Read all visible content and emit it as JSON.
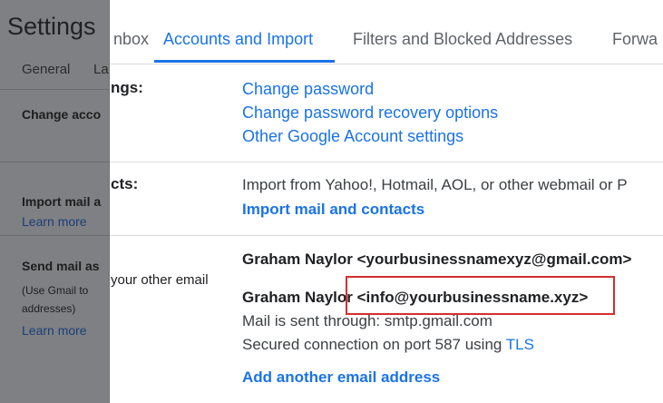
{
  "overlay": {
    "title": "Settings",
    "tabs": [
      "General",
      "La"
    ],
    "sections": {
      "change_account": "Change acco",
      "import_mail": "Import mail a",
      "import_learn_more": "Learn more",
      "send_mail": "Send mail as",
      "send_desc_1": "(Use Gmail to",
      "send_desc_2": "addresses)",
      "send_learn_more": "Learn more"
    }
  },
  "tabs": [
    "Inbox",
    "Accounts and Import",
    "Filters and Blocked Addresses",
    "Forwa"
  ],
  "tabs_visible": [
    "nbox",
    "Accounts and Import",
    "Filters and Blocked Addresses",
    "Forwa"
  ],
  "sections": {
    "change_account": {
      "label_tail": "ngs:",
      "links": [
        "Change password",
        "Change password recovery options",
        "Other Google Account settings"
      ]
    },
    "import": {
      "label_tail": "cts:",
      "description": "Import from Yahoo!, Hotmail, AOL, or other webmail or P",
      "link": "Import mail and contacts"
    },
    "send_mail_as": {
      "label_tail": "your other email",
      "address_1": "Graham Naylor <yourbusinessnamexyz@gmail.com>",
      "address_2": "Graham Naylor <info@yourbusinessname.xyz>",
      "sent_through": "Mail is sent through: smtp.gmail.com",
      "secured_prefix": "Secured connection on port 587 using",
      "secured_link": "TLS",
      "add_link": "Add another email address"
    }
  },
  "colors": {
    "accent": "#1a73e8",
    "highlight_border": "#d32f2f",
    "overlay_bg": "#7f8083"
  }
}
